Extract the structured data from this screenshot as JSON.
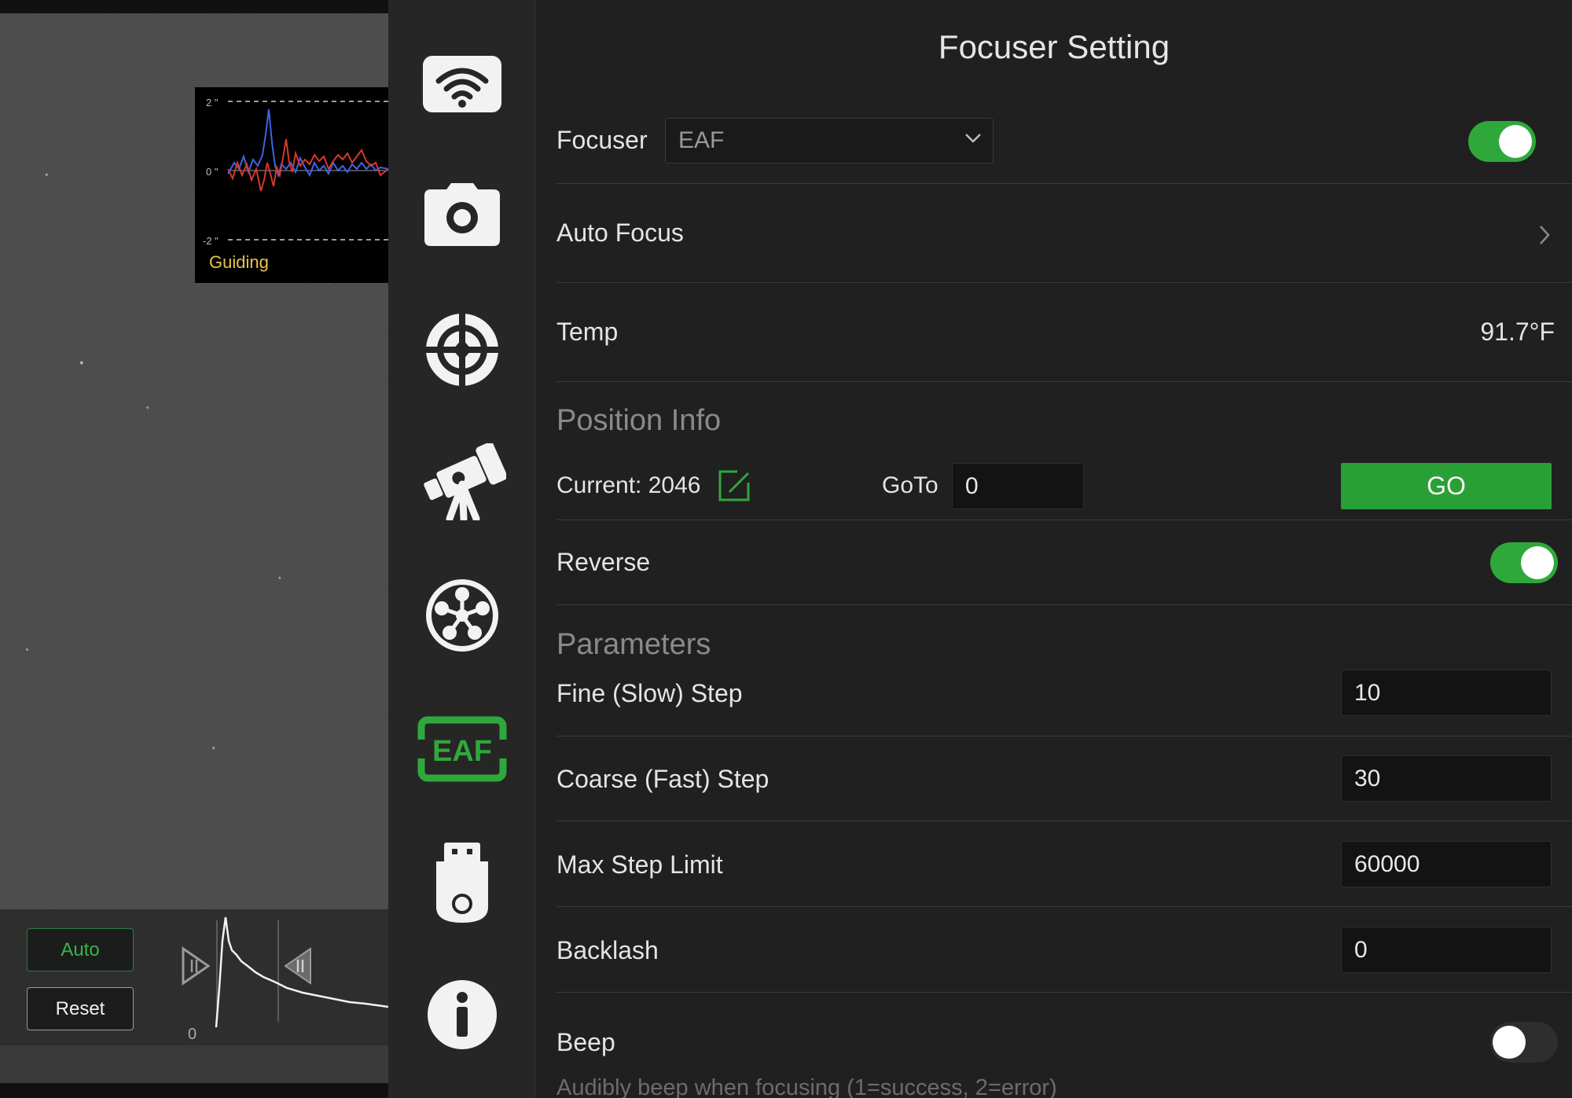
{
  "guide_graph": {
    "label": "Guiding",
    "ticks": [
      "2 \"",
      "0 \"",
      "-2 \""
    ],
    "colors": {
      "ra": "#d23a2a",
      "dec": "#3f63e6",
      "label": "#e8c24a"
    }
  },
  "histogram": {
    "auto_label": "Auto",
    "reset_label": "Reset",
    "zero_label": "0"
  },
  "sidebar": {
    "items": [
      {
        "name": "wifi-icon"
      },
      {
        "name": "camera-icon"
      },
      {
        "name": "guide-crosshair-icon"
      },
      {
        "name": "telescope-icon"
      },
      {
        "name": "filter-wheel-icon"
      },
      {
        "name": "eaf-focuser-icon",
        "text": "EAF",
        "color": "#2fa83b"
      },
      {
        "name": "usb-storage-icon"
      },
      {
        "name": "info-icon"
      }
    ]
  },
  "panel": {
    "title": "Focuser Setting",
    "focuser": {
      "label": "Focuser",
      "selected": "EAF",
      "enabled": true
    },
    "auto_focus": {
      "label": "Auto Focus"
    },
    "temp": {
      "label": "Temp",
      "value": "91.7°F"
    },
    "position_info": {
      "header": "Position Info",
      "current_label": "Current: 2046",
      "goto_label": "GoTo",
      "goto_value": "0",
      "go_button": "GO"
    },
    "reverse": {
      "label": "Reverse",
      "enabled": true
    },
    "parameters": {
      "header": "Parameters",
      "fine_step": {
        "label": "Fine (Slow) Step",
        "value": "10"
      },
      "coarse_step": {
        "label": "Coarse (Fast) Step",
        "value": "30"
      },
      "max_step": {
        "label": "Max Step Limit",
        "value": "60000"
      },
      "backlash": {
        "label": "Backlash",
        "value": "0"
      }
    },
    "beep": {
      "label": "Beep",
      "enabled": false,
      "description": "Audibly beep when focusing (1=success, 2=error)"
    },
    "colors": {
      "accent_green": "#2fa83b",
      "background": "#202020"
    }
  }
}
